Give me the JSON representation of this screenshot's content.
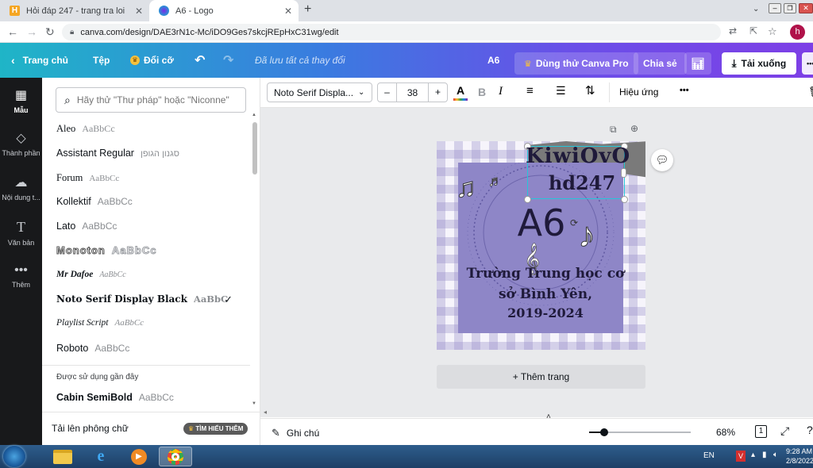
{
  "browser": {
    "tabs": [
      {
        "title": "Hỏi đáp 247 - trang tra loi",
        "active": false
      },
      {
        "title": "A6 - Logo",
        "active": true
      }
    ],
    "new_tab": "+",
    "url": "canva.com/design/DAE3rN1c-Mc/iDO9Ges7skcjREpHxC31wg/edit",
    "profile_initial": "h"
  },
  "topbar": {
    "home": "Trang chủ",
    "file": "Tệp",
    "resize": "Đổi cỡ",
    "saved_status": "Đã lưu tất cả thay đổi",
    "doc_title": "A6",
    "try_pro": "Dùng thử Canva Pro",
    "share": "Chia sẻ",
    "download": "Tải xuống",
    "more": "•••"
  },
  "rail": {
    "items": [
      {
        "label": "Mẫu"
      },
      {
        "label": "Thành phần"
      },
      {
        "label": "Nội dung t..."
      },
      {
        "label": "Văn bản"
      },
      {
        "label": "Thêm"
      }
    ]
  },
  "font_panel": {
    "search_placeholder": "Hãy thử \"Thư pháp\" hoặc \"Niconne\"",
    "fonts": [
      {
        "name": "Aleo",
        "sample": "AaBbCc"
      },
      {
        "name": "Assistant Regular",
        "sample": "סגנון הגופן"
      },
      {
        "name": "Forum",
        "sample": "AaBbCc"
      },
      {
        "name": "Kollektif",
        "sample": "AaBbCc"
      },
      {
        "name": "Lato",
        "sample": "AaBbCc"
      },
      {
        "name": "Monoton",
        "sample": "AaBbCc"
      },
      {
        "name": "Mr Dafoe",
        "sample": "AaBbCc"
      },
      {
        "name": "Noto Serif Display Black",
        "sample": "AaBbCc",
        "selected": true,
        "check": "✓"
      },
      {
        "name": "Playlist Script",
        "sample": "AaBbCc"
      },
      {
        "name": "Roboto",
        "sample": "AaBbCc"
      }
    ],
    "recent_heading": "Được sử dụng gần đây",
    "recent_fonts": [
      {
        "name": "Cabin SemiBold",
        "sample": "AaBbCc"
      }
    ],
    "upload_label": "Tải lên phông chữ",
    "learn_more": "TÌM HIỂU THÊM"
  },
  "format_bar": {
    "font_name": "Noto Serif Displa...",
    "decrease": "–",
    "font_size": "38",
    "increase": "+",
    "color_letter": "A",
    "bold": "B",
    "italic": "I",
    "effects": "Hiệu ứng",
    "more": "•••"
  },
  "design": {
    "line1": "KiwiOvO",
    "line2": "hd247",
    "logo": "A6",
    "school": "Trường Trung học cơ sở Bình Yên,",
    "years": "2019-2024"
  },
  "canvas": {
    "add_page": "+ Thêm trang"
  },
  "bottombar": {
    "notes": "Ghi chú",
    "zoom_percent": "68%",
    "page_count": "1",
    "zoom_fraction": 0.15
  },
  "taskbar": {
    "lang": "EN",
    "time": "9:28 AM",
    "date": "2/8/2022"
  },
  "colors": {
    "rail_bg": "#18191b",
    "design_purple": "#8e86c7",
    "selection": "#26c6da",
    "text_dark": "#1f1a3a"
  }
}
